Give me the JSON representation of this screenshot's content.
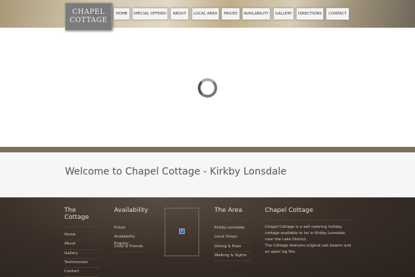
{
  "logo": {
    "line1": "CHAPEL",
    "line2": "COTTAGE"
  },
  "nav": [
    "HOME",
    "SPECIAL OFFERS!",
    "ABOUT",
    "LOCAL AREA",
    "PRICES",
    "AVAILABILITY",
    "GALLERY",
    "DIRECTIONS",
    "CONTACT"
  ],
  "welcome": "Welcome to Chapel Cottage - Kirkby Lonsdale",
  "footer": {
    "cottage": {
      "title": "The Cottage",
      "links": [
        "Home",
        "About",
        "Gallery",
        "Testimonials",
        "Contact"
      ]
    },
    "availability": {
      "title": "Availability",
      "links": [
        "Prices",
        "Availability Enquiry",
        "Links & Friends"
      ]
    },
    "area": {
      "title": "The Area",
      "links": [
        "Kirkby Lonsdale",
        "Local Shops",
        "Dining & Pubs",
        "Walking & Sights"
      ]
    },
    "about": {
      "title": "Chapel Cottage",
      "text1": "Chapel Cottage is a self catering holiday cottage available to let in Kirkby Lonsdale, near the Lake District.",
      "text2": "The Cottage features original oak beams and an open log fire."
    },
    "widget_icon": "f"
  }
}
